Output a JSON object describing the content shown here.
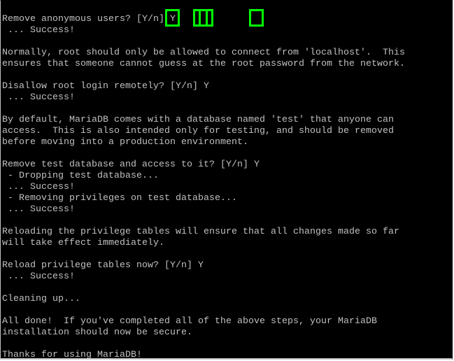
{
  "terminal": {
    "theme": {
      "background": "#000000",
      "foreground": "#c0c0c0",
      "highlight": "#00ff00"
    },
    "lines": [
      {
        "text": "Remove anonymous users? [Y/n] ",
        "answer": "Y"
      },
      {
        "text": " ... Success!"
      },
      {
        "text": ""
      },
      {
        "text": "Normally, root should only be allowed to connect from 'localhost'.  This"
      },
      {
        "text": "ensures that someone cannot guess at the root password from the network."
      },
      {
        "text": ""
      },
      {
        "text": "Disallow root login remotely? [Y/n] ",
        "answer": "Y"
      },
      {
        "text": " ... Success!"
      },
      {
        "text": ""
      },
      {
        "text": "By default, MariaDB comes with a database named 'test' that anyone can"
      },
      {
        "text": "access.  This is also intended only for testing, and should be removed"
      },
      {
        "text": "before moving into a production environment."
      },
      {
        "text": ""
      },
      {
        "text": "Remove test database and access to it? [Y/n] ",
        "answer": "Y"
      },
      {
        "text": " - Dropping test database..."
      },
      {
        "text": " ... Success!"
      },
      {
        "text": " - Removing privileges on test database..."
      },
      {
        "text": " ... Success!"
      },
      {
        "text": ""
      },
      {
        "text": "Reloading the privilege tables will ensure that all changes made so far"
      },
      {
        "text": "will take effect immediately."
      },
      {
        "text": ""
      },
      {
        "text": "Reload privilege tables now? [Y/n] ",
        "answer": "Y"
      },
      {
        "text": " ... Success!"
      },
      {
        "text": ""
      },
      {
        "text": "Cleaning up..."
      },
      {
        "text": ""
      },
      {
        "text": "All done!  If you've completed all of the above steps, your MariaDB"
      },
      {
        "text": "installation should now be secure."
      },
      {
        "text": ""
      },
      {
        "text": "Thanks for using MariaDB!"
      }
    ]
  }
}
